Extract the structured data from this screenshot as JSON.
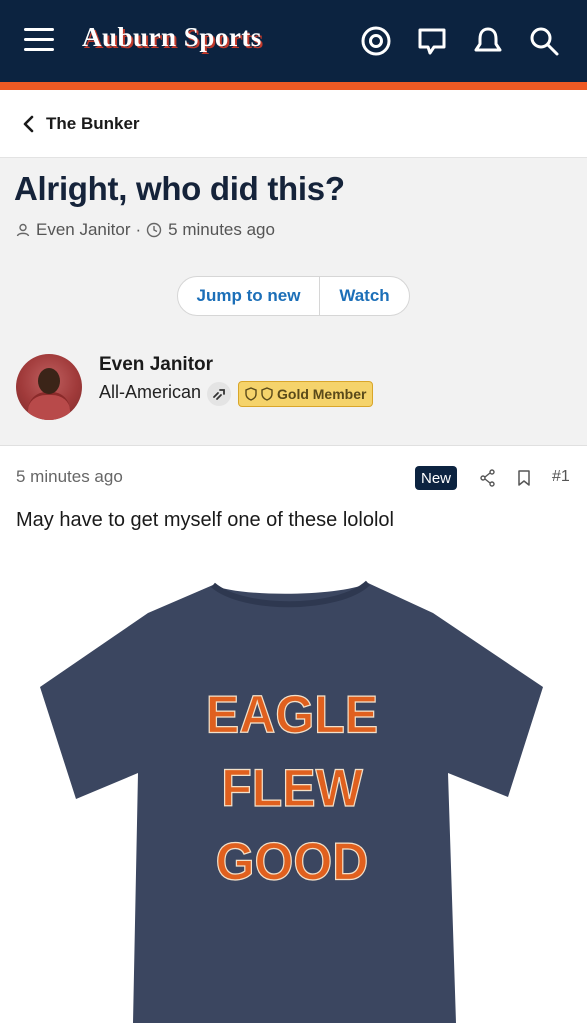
{
  "header": {
    "logo_text": "Auburn Sports",
    "icons": [
      "menu-icon",
      "account-icon",
      "conversations-icon",
      "alerts-icon",
      "search-icon"
    ],
    "colors": {
      "navy": "#0c2340",
      "orange": "#ee5a24"
    }
  },
  "breadcrumb": {
    "label": "The Bunker"
  },
  "thread": {
    "title": "Alright, who did this?",
    "author": "Even Janitor",
    "separator": "·",
    "time": "5 minutes ago",
    "jump_label": "Jump to new",
    "watch_label": "Watch"
  },
  "user": {
    "name": "Even Janitor",
    "title": "All-American",
    "badge": "Gold Member"
  },
  "post": {
    "time": "5 minutes ago",
    "new_label": "New",
    "number": "#1",
    "text": "May have to get myself one of these lololol",
    "image": {
      "line1": "EAGLE",
      "line2": "FLEW",
      "line3": "GOOD",
      "shirt_color": "#3b4660",
      "text_color": "#e0601e"
    }
  }
}
